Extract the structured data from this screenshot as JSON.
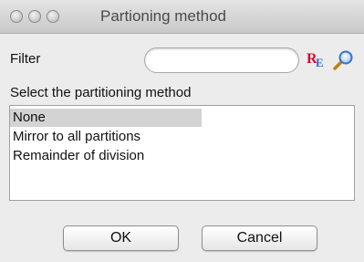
{
  "window": {
    "title": "Partioning method"
  },
  "filter": {
    "label": "Filter",
    "value": "",
    "placeholder": "",
    "regex_icon": {
      "r": "R",
      "e": "E"
    }
  },
  "list": {
    "label": "Select the partitioning method",
    "items": [
      {
        "label": "None",
        "selected": true
      },
      {
        "label": "Mirror to all partitions",
        "selected": false
      },
      {
        "label": "Remainder of division",
        "selected": false
      }
    ]
  },
  "buttons": {
    "ok_label": "OK",
    "cancel_label": "Cancel"
  },
  "icons": {
    "regex": "regex-icon",
    "search": "search-icon"
  },
  "colors": {
    "selection": "#d3d3d3",
    "regex_r": "#c8102e",
    "regex_e": "#2a6fd6"
  }
}
